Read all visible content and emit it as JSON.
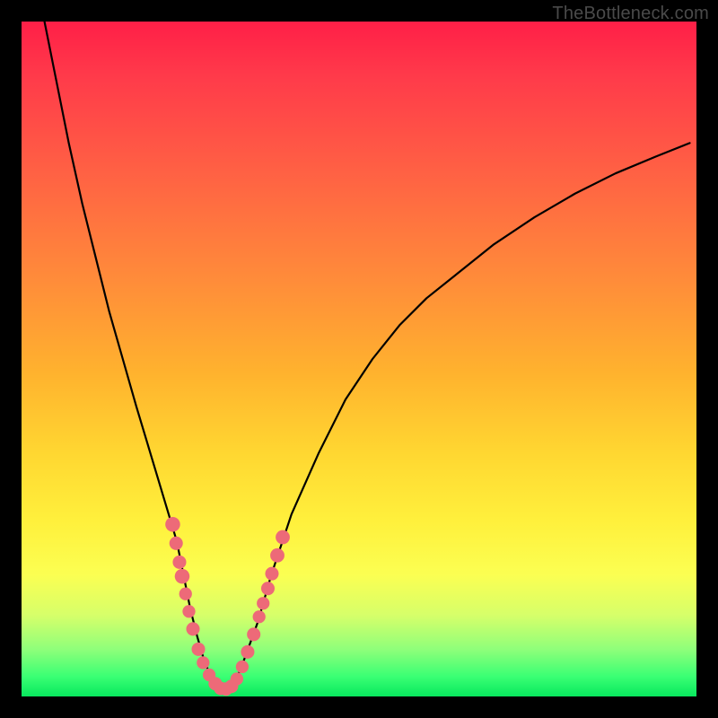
{
  "watermark": "TheBottleneck.com",
  "colors": {
    "gradient_top": "#ff1f47",
    "gradient_mid": "#ffd731",
    "gradient_bottom": "#08e85e",
    "curve": "#000000",
    "marker": "#ed6a78",
    "frame": "#000000"
  },
  "chart_data": {
    "type": "line",
    "title": "",
    "xlabel": "",
    "ylabel": "",
    "xlim": [
      0,
      100
    ],
    "ylim": [
      0,
      100
    ],
    "grid": false,
    "legend": false,
    "x_is_percent_across_plot": true,
    "y_is_percent_from_bottom": true,
    "series": [
      {
        "name": "bottleneck-curve",
        "x": [
          3.4,
          5,
          7,
          9,
          11,
          13,
          15,
          17,
          18.5,
          20,
          21.5,
          23,
          24,
          25,
          26,
          27,
          28,
          29,
          30,
          31,
          32,
          33,
          35,
          37,
          40,
          44,
          48,
          52,
          56,
          60,
          65,
          70,
          76,
          82,
          88,
          94,
          99
        ],
        "y": [
          100,
          92,
          82,
          73,
          65,
          57,
          50,
          43,
          38,
          33,
          28,
          23,
          18,
          13,
          9,
          5.5,
          3,
          1.6,
          1,
          1.4,
          3,
          5.5,
          11,
          18,
          27,
          36,
          44,
          50,
          55,
          59,
          63,
          67,
          71,
          74.5,
          77.5,
          80,
          82
        ]
      }
    ],
    "markers": {
      "name": "highlighted-points",
      "points": [
        {
          "x": 22.4,
          "y": 25.5,
          "r": 1.1
        },
        {
          "x": 22.9,
          "y": 22.7,
          "r": 1.0
        },
        {
          "x": 23.4,
          "y": 19.9,
          "r": 1.0
        },
        {
          "x": 23.8,
          "y": 17.8,
          "r": 1.1
        },
        {
          "x": 24.3,
          "y": 15.2,
          "r": 0.95
        },
        {
          "x": 24.8,
          "y": 12.6,
          "r": 0.95
        },
        {
          "x": 25.4,
          "y": 10.0,
          "r": 1.0
        },
        {
          "x": 26.2,
          "y": 7.0,
          "r": 1.0
        },
        {
          "x": 26.9,
          "y": 5.0,
          "r": 0.95
        },
        {
          "x": 27.8,
          "y": 3.2,
          "r": 0.95
        },
        {
          "x": 28.7,
          "y": 1.9,
          "r": 1.0
        },
        {
          "x": 29.5,
          "y": 1.2,
          "r": 1.0
        },
        {
          "x": 30.3,
          "y": 1.1,
          "r": 1.0
        },
        {
          "x": 31.1,
          "y": 1.5,
          "r": 1.0
        },
        {
          "x": 31.9,
          "y": 2.6,
          "r": 0.95
        },
        {
          "x": 32.7,
          "y": 4.4,
          "r": 0.95
        },
        {
          "x": 33.5,
          "y": 6.6,
          "r": 1.0
        },
        {
          "x": 34.4,
          "y": 9.2,
          "r": 1.0
        },
        {
          "x": 35.2,
          "y": 11.8,
          "r": 0.95
        },
        {
          "x": 35.8,
          "y": 13.8,
          "r": 0.95
        },
        {
          "x": 36.5,
          "y": 16.0,
          "r": 1.0
        },
        {
          "x": 37.1,
          "y": 18.2,
          "r": 1.0
        },
        {
          "x": 37.9,
          "y": 20.9,
          "r": 1.05
        },
        {
          "x": 38.7,
          "y": 23.6,
          "r": 1.05
        }
      ]
    }
  }
}
